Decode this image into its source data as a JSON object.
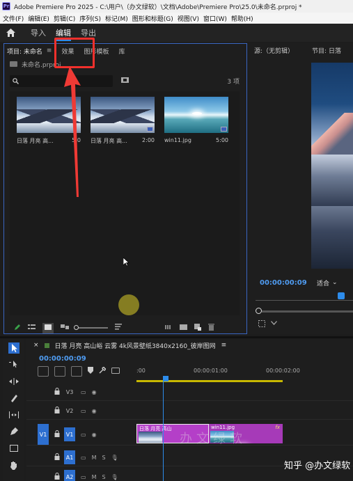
{
  "titlebar": {
    "title": "Adobe Premiere Pro 2025 - C:\\用户\\（办文绿软）\\文档\\Adobe\\Premiere Pro\\25.0\\未命名.prproj *"
  },
  "menu": [
    "文件(F)",
    "编辑(E)",
    "剪辑(C)",
    "序列(S)",
    "标记(M)",
    "图形和标题(G)",
    "视图(V)",
    "窗口(W)",
    "帮助(H)"
  ],
  "workspace": {
    "tabs": [
      "导入",
      "编辑",
      "导出"
    ],
    "active": "编辑"
  },
  "project_panel": {
    "tabs": {
      "project": "项目: 未命名",
      "effects": "效果",
      "graphics": "图形模板",
      "library": "库"
    },
    "path": "未命名.prproj",
    "item_count": "3 项",
    "clips": [
      {
        "name": "日落 月亮 高...",
        "duration": "5:0"
      },
      {
        "name": "日落 月亮 高...",
        "duration": "2:00"
      },
      {
        "name": "win11.jpg",
        "duration": "5:00"
      }
    ]
  },
  "monitor": {
    "source_tab": "源:（无剪辑）",
    "program_tab": "节目: 日落",
    "timecode": "00:00:00:09",
    "fit": "适合"
  },
  "timeline": {
    "sequence_name": "日落 月亮 高山峪 云雾 4k风景壁纸3840x2160_彼岸图网",
    "timecode": "00:00:00:09",
    "ruler": [
      ":00",
      "00:00:01:00",
      "00:00:02:00"
    ],
    "tracks": {
      "v3": "V3",
      "v2": "V2",
      "v1": "V1",
      "v1_source": "V1",
      "a1": "A1",
      "a2": "A2",
      "m": "M",
      "s": "S"
    },
    "clip_a_label": "日落 月亮 高山",
    "clip_b_label": "win11.jpg",
    "fx": "fx"
  },
  "overlay_watermark": "办文绿软",
  "watermark": "知乎 @办文绿软",
  "colors": {
    "accent": "#2d8ceb",
    "clip": "#b43fc8",
    "highlight": "#f2302c"
  }
}
